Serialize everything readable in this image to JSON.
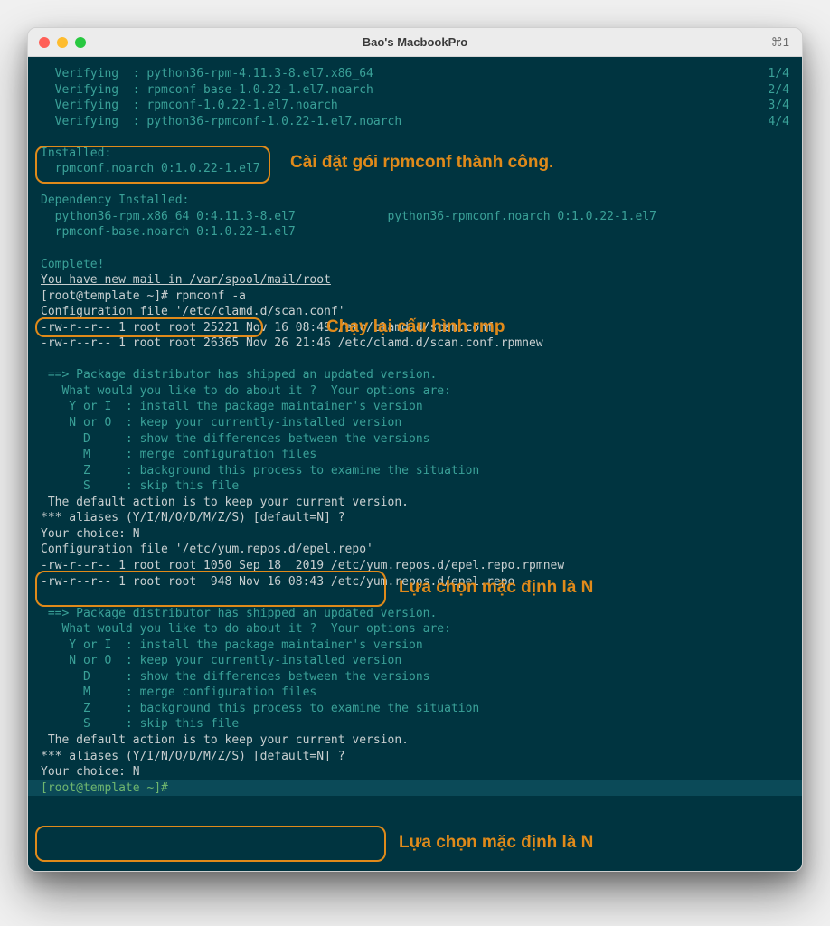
{
  "window": {
    "title": "Bao's MacbookPro",
    "shortcut": "⌘1"
  },
  "verify": [
    {
      "label": "Verifying  : python36-rpm-4.11.3-8.el7.x86_64",
      "count": "1/4"
    },
    {
      "label": "Verifying  : rpmconf-base-1.0.22-1.el7.noarch",
      "count": "2/4"
    },
    {
      "label": "Verifying  : rpmconf-1.0.22-1.el7.noarch",
      "count": "3/4"
    },
    {
      "label": "Verifying  : python36-rpmconf-1.0.22-1.el7.noarch",
      "count": "4/4"
    }
  ],
  "installed": {
    "header": "Installed:",
    "pkg": "  rpmconf.noarch 0:1.0.22-1.el7"
  },
  "dep_installed": {
    "header": "Dependency Installed:",
    "pkg1": "  python36-rpm.x86_64 0:4.11.3-8.el7",
    "pkg2": "python36-rpmconf.noarch 0:1.0.22-1.el7",
    "pkg3": "  rpmconf-base.noarch 0:1.0.22-1.el7"
  },
  "complete": "Complete!",
  "mail": "You have new mail in /var/spool/mail/root",
  "cmd": {
    "prompt": "[root@template ~]# ",
    "text": "rpmconf -a"
  },
  "conf1": {
    "file": "Configuration file '/etc/clamd.d/scan.conf'",
    "l1": "-rw-r--r-- 1 root root 25221 Nov 16 08:49 /etc/clamd.d/scan.conf",
    "l2": "-rw-r--r-- 1 root root 26365 Nov 26 21:46 /etc/clamd.d/scan.conf.rpmnew"
  },
  "options": {
    "intro1": " ==> Package distributor has shipped an updated version.",
    "intro2": "   What would you like to do about it ?  Your options are:",
    "y": "    Y or I  : install the package maintainer's version",
    "n": "    N or O  : keep your currently-installed version",
    "d": "      D     : show the differences between the versions",
    "m": "      M     : merge configuration files",
    "z": "      Z     : background this process to examine the situation",
    "s": "      S     : skip this file",
    "default": " The default action is to keep your current version."
  },
  "choice": {
    "aliases": "*** aliases (Y/I/N/O/D/M/Z/S) [default=N] ? ",
    "your": "Your choice: N"
  },
  "conf2": {
    "file": "Configuration file '/etc/yum.repos.d/epel.repo'",
    "l1": "-rw-r--r-- 1 root root 1050 Sep 18  2019 /etc/yum.repos.d/epel.repo.rpmnew",
    "l2": "-rw-r--r-- 1 root root  948 Nov 16 08:43 /etc/yum.repos.d/epel.repo"
  },
  "final_prompt": "[root@template ~]# ",
  "annotations": {
    "a1": "Cài đặt gói rpmconf thành công.",
    "a2": "Chạy lại cấu hình rmp",
    "a3": "Lựa chọn mặc định là N",
    "a4": "Lựa chọn mặc định là N"
  }
}
